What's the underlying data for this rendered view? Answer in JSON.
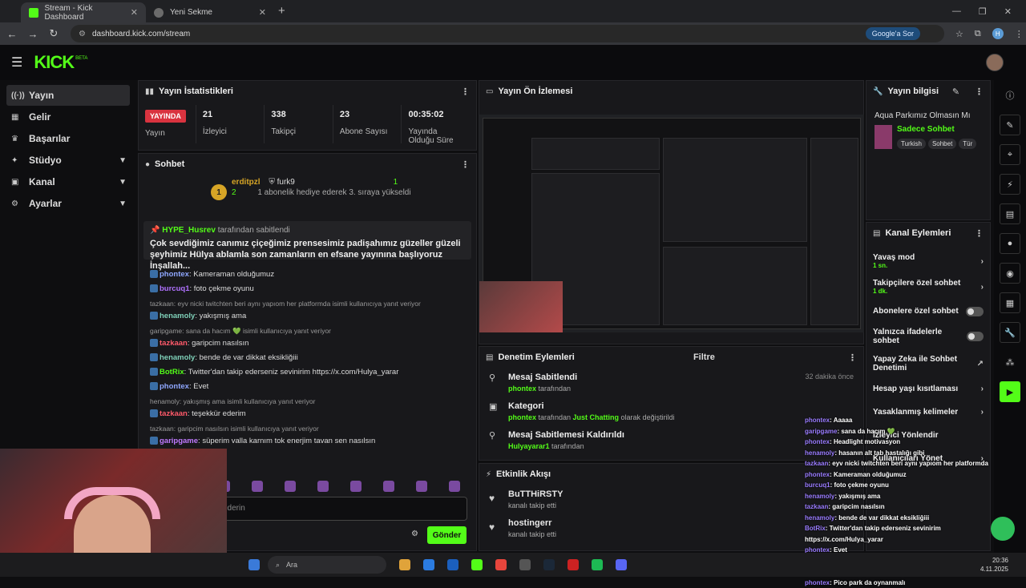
{
  "browser": {
    "tabs": [
      {
        "title": "Stream - Kick Dashboard"
      },
      {
        "title": "Yeni Sekme"
      }
    ],
    "url": "dashboard.kick.com/stream",
    "google_btn": "Google'a Sor",
    "profile_letter": "H"
  },
  "app": {
    "logo": "KICK",
    "beta": "BETA"
  },
  "sidebar": {
    "items": [
      {
        "label": "Yayın",
        "icon": "radio-icon"
      },
      {
        "label": "Gelir",
        "icon": "bank-icon"
      },
      {
        "label": "Başarılar",
        "icon": "trophy-icon"
      },
      {
        "label": "Stüdyo",
        "icon": "studio-icon"
      },
      {
        "label": "Kanal",
        "icon": "channel-icon"
      },
      {
        "label": "Ayarlar",
        "icon": "gear-icon"
      }
    ]
  },
  "stats": {
    "title": "Yayın İstatistikleri",
    "live_badge": "YAYINDA",
    "live_label": "Yayın",
    "items": [
      {
        "value": "21",
        "label": "İzleyici"
      },
      {
        "value": "338",
        "label": "Takipçi"
      },
      {
        "value": "23",
        "label": "Abone Sayısı"
      },
      {
        "value": "00:35:02",
        "label": "Yayında Olduğu Süre"
      }
    ]
  },
  "chat": {
    "title": "Sohbet",
    "top_gifter": {
      "user1": "erditpzl",
      "count1": "2",
      "user2": "furk9",
      "count2": "1",
      "note": "1 abonelik hediye ederek 3. sıraya yükseldi",
      "rank": "1"
    },
    "pinned": {
      "user": "HYPE_Husrev",
      "suffix": "tarafından sabitlendi",
      "text": "Çok sevdiğimiz canımız çiçeğimiz prensesimiz padişahımız güzeller güzeli şeyhimiz Hülya ablamla son zamanların en efsane yayınına başlıyoruz İnşallah..."
    },
    "messages": [
      {
        "reply": "",
        "user": "phontex",
        "color": "#8fa7ff",
        "text": ": Kameraman olduğumuz"
      },
      {
        "reply": "",
        "user": "burcuq1",
        "color": "#b072ff",
        "text": ": foto çekme oyunu"
      },
      {
        "reply": "tazkaan: eyv nicki twitchten beri aynı yapıom her platformda isimli kullanıcıya yanıt veriyor",
        "user": "henamoly",
        "color": "#7fd1b9",
        "text": ": yakışmış ama"
      },
      {
        "reply": "garipgame: sana da hacım 💚 isimli kullanıcıya yanıt veriyor",
        "user": "tazkaan",
        "color": "#ff5a6a",
        "text": ": garipcim nasılsın"
      },
      {
        "reply": "",
        "user": "henamoly",
        "color": "#7fd1b9",
        "text": ": bende de var dikkat eksikliğiii"
      },
      {
        "reply": "",
        "user": "BotRix",
        "color": "#53fc18",
        "text": ": Twitter'dan takip ederseniz sevinirim https://x.com/Hulya_yarar"
      },
      {
        "reply": "",
        "user": "phontex",
        "color": "#8fa7ff",
        "text": ": Evet"
      },
      {
        "reply": "henamoly: yakışmış ama isimli kullanıcıya yanıt veriyor",
        "user": "tazkaan",
        "color": "#ff5a6a",
        "text": ": teşekkür ederim"
      },
      {
        "reply": "tazkaan: garipcim nasılsın isimli kullanıcıya yanıt veriyor",
        "user": "garipgame",
        "color": "#c07aff",
        "text": ": süperim valla karnım tok enerjim tavan sen nasılsın"
      },
      {
        "reply": "",
        "user": "",
        "color": "#dddddd",
        "text": "o park da oynanmalı"
      }
    ],
    "input_placeholder": "ederin",
    "send": "Gönder"
  },
  "preview": {
    "title": "Yayın Ön İzlemesi"
  },
  "moderation": {
    "title": "Denetim Eylemleri",
    "filter": "Filtre",
    "rows": [
      {
        "title": "Mesaj Sabitlendi",
        "user": "phontex",
        "mid": " tarafından",
        "extra": "",
        "tail": "",
        "time": "32 dakika önce",
        "icon": "pin-icon"
      },
      {
        "title": "Kategori",
        "user": "phontex",
        "mid": " tarafından ",
        "extra": "Just Chatting",
        "tail": " olarak değiştirildi",
        "time": "",
        "icon": "category-icon"
      },
      {
        "title": "Mesaj Sabitlemesi Kaldırıldı",
        "user": "Hulyayarar1",
        "mid": " tarafından",
        "extra": "",
        "tail": "",
        "time": "",
        "icon": "unpin-icon"
      }
    ]
  },
  "events": {
    "title": "Etkinlik Akışı",
    "rows": [
      {
        "user": "BuTTHiRSTY",
        "text": "kanalı takip etti"
      },
      {
        "user": "hostingerr",
        "text": "kanalı takip etti"
      }
    ]
  },
  "stream_info": {
    "title": "Yayın bilgisi",
    "stream_title": "Aqua Parkımız Olmasın Mı",
    "category": "Sadece Sohbet",
    "tags": [
      "Turkish",
      "Sohbet",
      "Tür"
    ]
  },
  "channel_actions": {
    "title": "Kanal Eylemleri",
    "rows": [
      {
        "label": "Yavaş mod",
        "sub": "1 sn.",
        "kind": "chevron"
      },
      {
        "label": "Takipçilere özel sohbet",
        "sub": "1 dk.",
        "kind": "chevron"
      },
      {
        "label": "Abonelere özel sohbet",
        "sub": "",
        "kind": "toggle"
      },
      {
        "label": "Yalnızca ifadelerle sohbet",
        "sub": "",
        "kind": "toggle"
      },
      {
        "label": "Yapay Zeka ile Sohbet Denetimi",
        "sub": "",
        "kind": "external"
      },
      {
        "label": "Hesap yaşı kısıtlaması",
        "sub": "",
        "kind": "chevron"
      },
      {
        "label": "Yasaklanmış kelimeler",
        "sub": "",
        "kind": "chevron"
      },
      {
        "label": "İzleyici Yönlendir",
        "sub": "",
        "kind": "none"
      },
      {
        "label": "Kullanıcıları Yönet",
        "sub": "",
        "kind": "chevron"
      }
    ]
  },
  "overlay_chat": [
    {
      "user": "phontex",
      "text": ": Aaaaa"
    },
    {
      "user": "garipgame",
      "text": ": sana da hacım 💚"
    },
    {
      "user": "phontex",
      "text": ": Headlight motivasyon"
    },
    {
      "user": "henamoly",
      "text": ": hasanın alt tab hastalığı gibi"
    },
    {
      "user": "tazkaan",
      "text": ": eyv nicki twitchten beri aynı yapıom her platformda"
    },
    {
      "user": "phontex",
      "text": ": Kameraman olduğumuz"
    },
    {
      "user": "burcuq1",
      "text": ": foto çekme oyunu"
    },
    {
      "user": "henamoly",
      "text": ": yakışmış ama"
    },
    {
      "user": "tazkaan",
      "text": ": garipcim nasılsın"
    },
    {
      "user": "henamoly",
      "text": ": bende de var dikkat eksikliğiii"
    },
    {
      "user": "BotRix",
      "text": ": Twitter'dan takip ederseniz sevinirim https://x.com/Hulya_yarar"
    },
    {
      "user": "phontex",
      "text": ": Evet"
    },
    {
      "user": "tazkaan",
      "text": ": teşekkür ederim"
    },
    {
      "user": "garipgame",
      "text": ": süperim valla karnım tok enerjim tavan sen nasılsın"
    },
    {
      "user": "phontex",
      "text": ": Pico park da oynanmalı"
    }
  ],
  "taskbar": {
    "search": "Ara",
    "time": "20:36",
    "date": "4.11.2025"
  }
}
